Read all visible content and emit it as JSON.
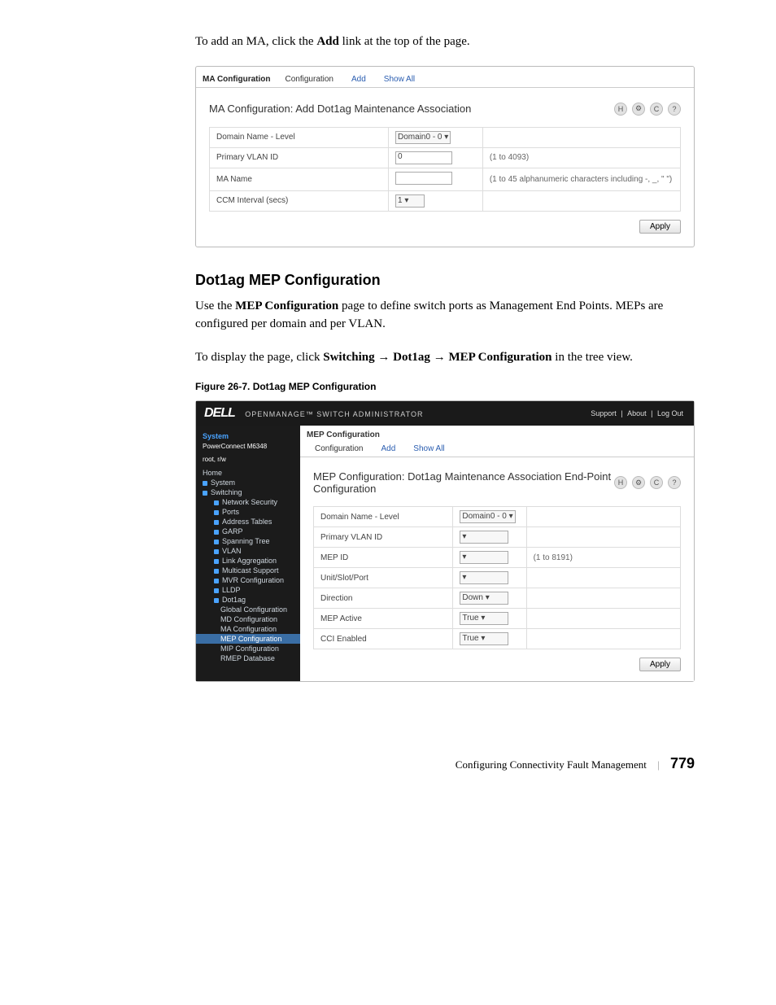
{
  "intro": {
    "prefix": "To add an MA, click the ",
    "bold": "Add",
    "suffix": " link at the top of the page."
  },
  "screenshot1": {
    "tab_title": "MA Configuration",
    "tabs": [
      "Configuration",
      "Add",
      "Show All"
    ],
    "heading": "MA Configuration: Add Dot1ag Maintenance Association",
    "icons": [
      "H",
      "⚙",
      "C",
      "?"
    ],
    "rows": [
      {
        "label": "Domain Name - Level",
        "control": "Domain0 - 0 ▾",
        "hint": ""
      },
      {
        "label": "Primary VLAN ID",
        "control": "0",
        "hint": "(1 to 4093)"
      },
      {
        "label": "MA Name",
        "control": "",
        "hint": "(1 to 45 alphanumeric characters including -, _, \" \")"
      },
      {
        "label": "CCM Interval (secs)",
        "control": "1  ▾",
        "hint": ""
      }
    ],
    "apply": "Apply"
  },
  "section": {
    "title": "Dot1ag MEP Configuration",
    "p1a": "Use the ",
    "p1b": "MEP Configuration",
    "p1c": " page to define switch ports as Management End Points. MEPs are configured per domain and per VLAN.",
    "p2a": "To display the page, click ",
    "p2b": "Switching",
    "arrow": " → ",
    "p2c": "Dot1ag",
    "p2d": "MEP Configuration",
    "p2e": " in the tree view."
  },
  "figure": {
    "caption": "Figure 26-7.    Dot1ag MEP Configuration"
  },
  "screenshot2": {
    "brand": "DELL",
    "subtitle": "OPENMANAGE™ SWITCH ADMINISTRATOR",
    "top_links": [
      "Support",
      "About",
      "Log Out"
    ],
    "sidebar": {
      "system": "System",
      "model": "PowerConnect M6348",
      "unit": "root, r/w",
      "nodes": [
        {
          "t": "Home",
          "cls": "h"
        },
        {
          "t": "System",
          "cls": "h ex"
        },
        {
          "t": "Switching",
          "cls": "h ex"
        },
        {
          "t": "Network Security",
          "cls": "l2 ex"
        },
        {
          "t": "Ports",
          "cls": "l2 ex"
        },
        {
          "t": "Address Tables",
          "cls": "l2 ex"
        },
        {
          "t": "GARP",
          "cls": "l2 ex"
        },
        {
          "t": "Spanning Tree",
          "cls": "l2 ex"
        },
        {
          "t": "VLAN",
          "cls": "l2 ex"
        },
        {
          "t": "Link Aggregation",
          "cls": "l2 ex"
        },
        {
          "t": "Multicast Support",
          "cls": "l2 ex"
        },
        {
          "t": "MVR Configuration",
          "cls": "l2 ex"
        },
        {
          "t": "LLDP",
          "cls": "l2 ex"
        },
        {
          "t": "Dot1ag",
          "cls": "l2 ex"
        },
        {
          "t": "Global Configuration",
          "cls": "l3"
        },
        {
          "t": "MD Configuration",
          "cls": "l3"
        },
        {
          "t": "MA Configuration",
          "cls": "l3"
        },
        {
          "t": "MEP Configuration",
          "cls": "l3 sel"
        },
        {
          "t": "MIP Configuration",
          "cls": "l3"
        },
        {
          "t": "RMEP Database",
          "cls": "l3"
        }
      ]
    },
    "main": {
      "tab_title": "MEP Configuration",
      "tabs": [
        "Configuration",
        "Add",
        "Show All"
      ],
      "heading": "MEP Configuration: Dot1ag Maintenance Association End-Point Configuration",
      "icons": [
        "H",
        "⚙",
        "C",
        "?"
      ],
      "rows": [
        {
          "label": "Domain Name - Level",
          "control": "Domain0 - 0 ▾",
          "hint": ""
        },
        {
          "label": "Primary VLAN ID",
          "control": "▾",
          "hint": ""
        },
        {
          "label": "MEP ID",
          "control": "▾",
          "hint": "(1 to 8191)"
        },
        {
          "label": "Unit/Slot/Port",
          "control": "▾",
          "hint": ""
        },
        {
          "label": "Direction",
          "control": "Down ▾",
          "hint": ""
        },
        {
          "label": "MEP Active",
          "control": "True ▾",
          "hint": ""
        },
        {
          "label": "CCI Enabled",
          "control": "True ▾",
          "hint": ""
        }
      ],
      "apply": "Apply"
    }
  },
  "footer": {
    "text": "Configuring Connectivity Fault Management",
    "page": "779"
  }
}
